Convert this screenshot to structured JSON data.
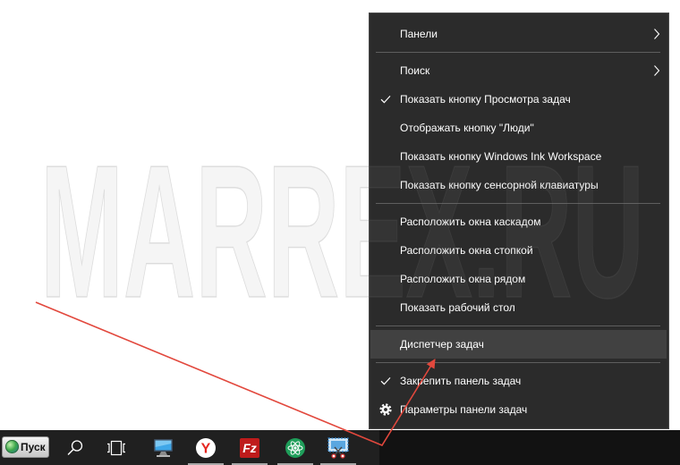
{
  "watermark": "MARREX.RU",
  "colors": {
    "page_bg": "#ffffff",
    "menu_bg": "#2b2b2b",
    "menu_border": "#4b4b4b",
    "menu_highlight": "#414141",
    "menu_text": "#ffffff",
    "separator": "#5e5e5e",
    "taskbar_bg": "#202020",
    "taskbar_dark": "#121212",
    "running_indicator": "#a8a8a8",
    "annotation": "#e2483d"
  },
  "context_menu": {
    "panels": {
      "label": "Панели",
      "has_submenu": true,
      "icon": "chevron-right-icon"
    },
    "search": {
      "label": "Поиск",
      "has_submenu": true,
      "icon": "chevron-right-icon"
    },
    "show_task_view_button": {
      "label": "Показать кнопку Просмотра задач",
      "checked": true,
      "icon": "checkmark-icon"
    },
    "show_people_button": {
      "label": "Отображать кнопку \"Люди\"",
      "checked": false
    },
    "show_ink_workspace_button": {
      "label": "Показать кнопку Windows Ink Workspace",
      "checked": false
    },
    "show_touch_keyboard_button": {
      "label": "Показать кнопку сенсорной клавиатуры",
      "checked": false
    },
    "cascade_windows": {
      "label": "Расположить окна каскадом"
    },
    "stack_windows": {
      "label": "Расположить окна стопкой"
    },
    "side_by_side_windows": {
      "label": "Расположить окна рядом"
    },
    "show_desktop": {
      "label": "Показать рабочий стол"
    },
    "task_manager": {
      "label": "Диспетчер задач",
      "highlighted": true
    },
    "lock_taskbar": {
      "label": "Закрепить панель задач",
      "checked": true,
      "icon": "checkmark-icon"
    },
    "taskbar_settings": {
      "label": "Параметры панели задач",
      "icon": "gear-icon"
    }
  },
  "taskbar": {
    "start_label": "Пуск",
    "start_icon": "windows-orb-icon",
    "search_icon": "search-icon",
    "task_view_icon": "task-view-icon",
    "apps": [
      {
        "icon": "computer-monitor-icon",
        "running": false
      },
      {
        "icon": "yandex-browser-icon",
        "logo_text": "Y",
        "running": true
      },
      {
        "icon": "filezilla-icon",
        "logo_text": "Fz",
        "running": true
      },
      {
        "icon": "atom-app-icon",
        "running": true
      },
      {
        "icon": "snipping-tool-icon",
        "running": true
      }
    ]
  }
}
